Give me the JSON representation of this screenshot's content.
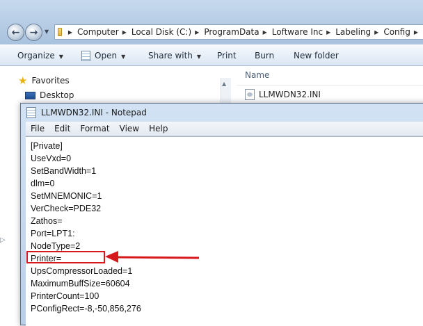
{
  "explorer": {
    "breadcrumb": [
      "Computer",
      "Local Disk (C:)",
      "ProgramData",
      "Loftware Inc",
      "Labeling",
      "Config"
    ],
    "toolbar": {
      "organize": "Organize",
      "open": "Open",
      "share_with": "Share with",
      "print": "Print",
      "burn": "Burn",
      "new_folder": "New folder"
    },
    "navpane": {
      "favorites": "Favorites",
      "desktop": "Desktop"
    },
    "filelist": {
      "column_name": "Name",
      "file_name": "LLMWDN32.INI"
    }
  },
  "notepad": {
    "title": "LLMWDN32.INI - Notepad",
    "menu": [
      "File",
      "Edit",
      "Format",
      "View",
      "Help"
    ],
    "lines": [
      "[Private]",
      "UseVxd=0",
      "SetBandWidth=1",
      "dlm=0",
      "SetMNEMONIC=1",
      "VerCheck=PDE32",
      "Zathos=",
      "Port=LPT1:",
      "NodeType=2",
      "Printer=",
      "UpsCompressorLoaded=1",
      "MaximumBuffSize=60604",
      "PrinterCount=100",
      "PConfigRect=-8,-50,856,276"
    ]
  },
  "annotation": {
    "highlight_color": "#d6171c"
  },
  "icons": {
    "back": "back-arrow-icon",
    "forward": "forward-arrow-icon",
    "folder": "folder-icon",
    "favorites": "star-icon",
    "desktop": "desktop-icon",
    "ini": "ini-file-icon",
    "notepad": "notepad-icon"
  }
}
